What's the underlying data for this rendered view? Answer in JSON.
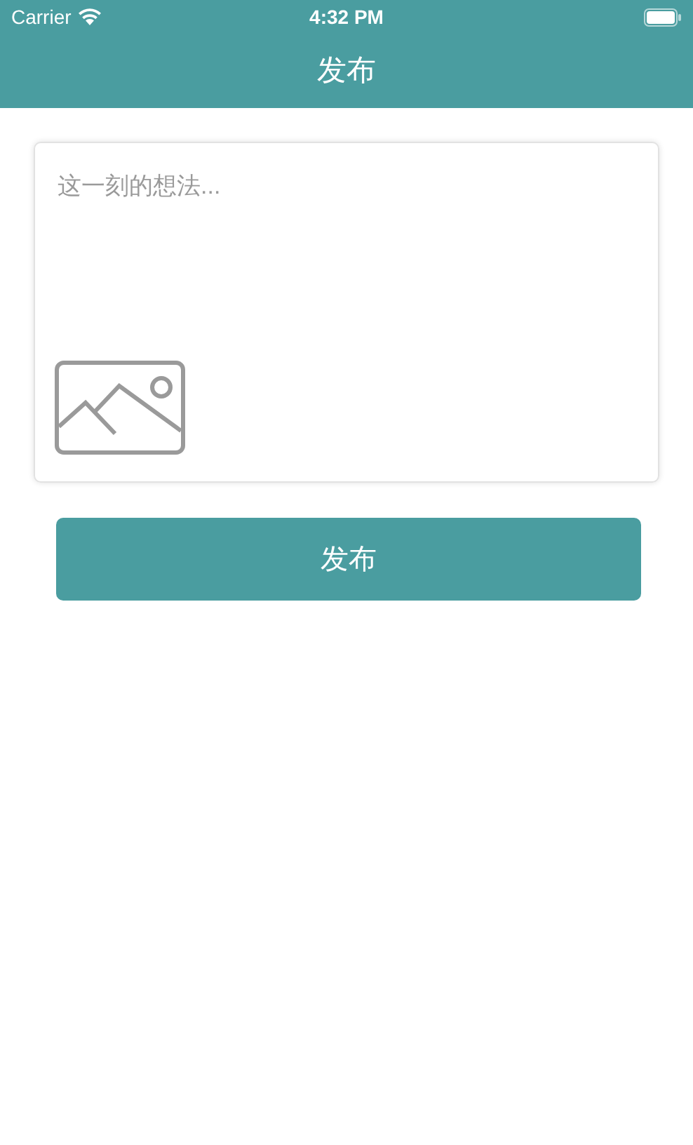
{
  "status_bar": {
    "carrier": "Carrier",
    "time": "4:32 PM"
  },
  "nav_bar": {
    "title": "发布"
  },
  "post_box": {
    "placeholder": "这一刻的想法..."
  },
  "submit_button": {
    "label": "发布"
  }
}
